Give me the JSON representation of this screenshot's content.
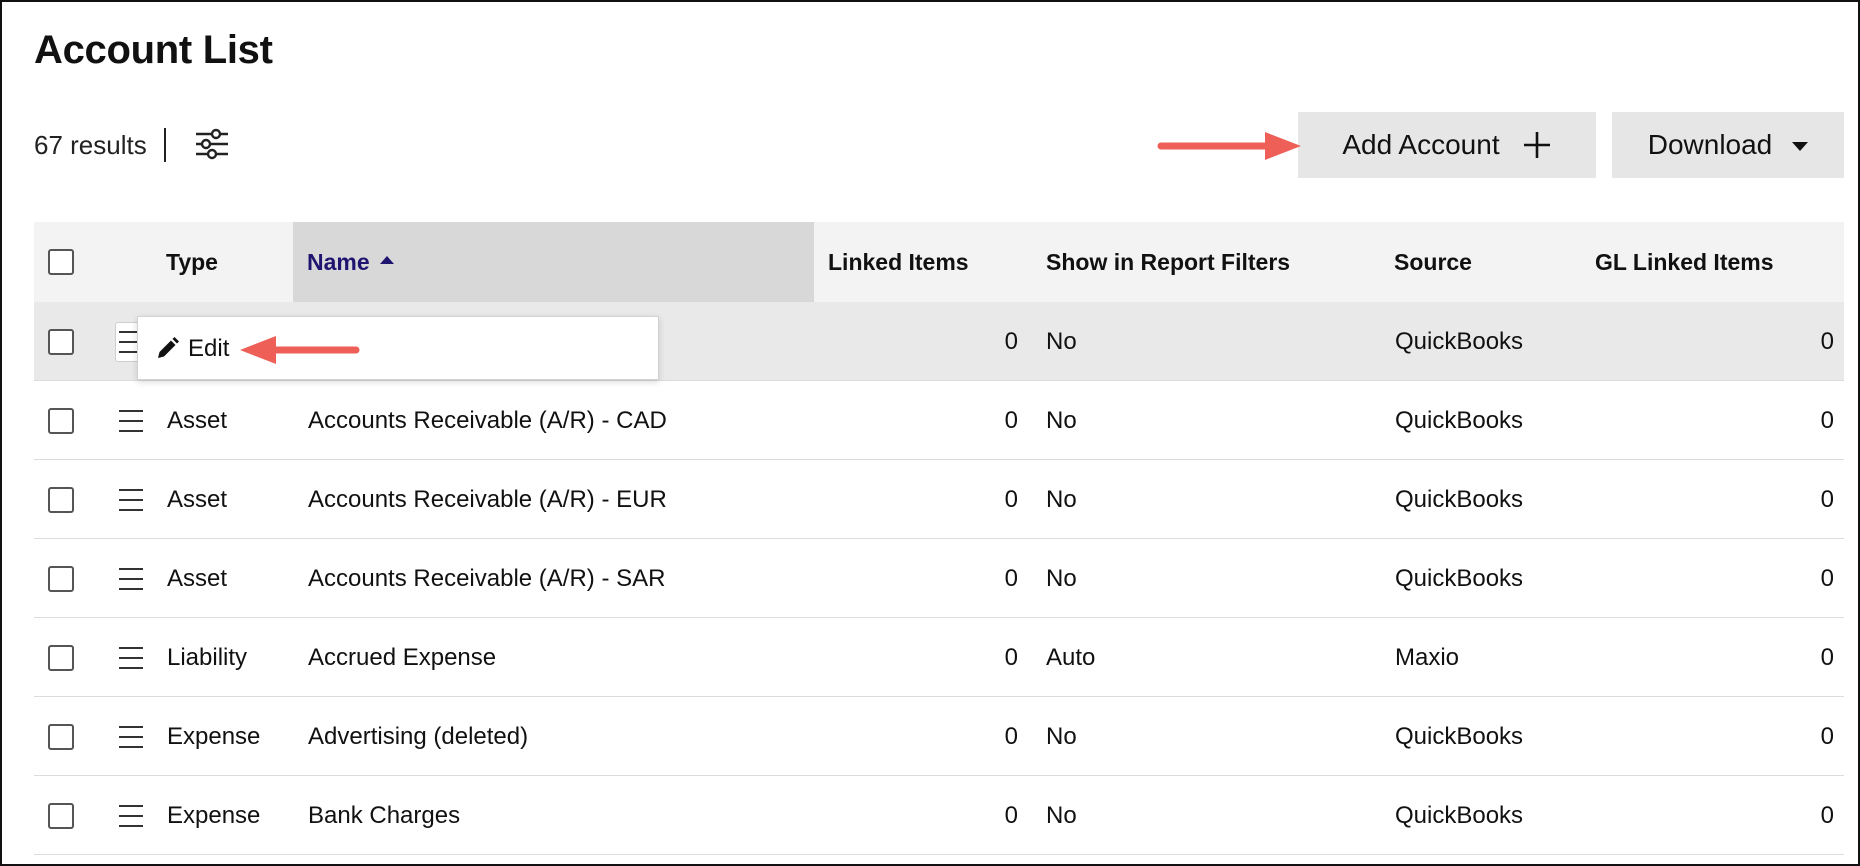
{
  "page": {
    "title": "Account List"
  },
  "toolbar": {
    "results": "67 results",
    "filter_icon": "sliders-icon",
    "add_label": "Add Account",
    "download_label": "Download"
  },
  "columns": {
    "type": "Type",
    "name": "Name",
    "linked_items": "Linked Items",
    "show_in_report_filters": "Show in Report Filters",
    "source": "Source",
    "gl_linked_items": "GL Linked Items"
  },
  "popup": {
    "edit_label": "Edit"
  },
  "rows": [
    {
      "type": "",
      "name": "",
      "linked": "0",
      "show": "No",
      "source": "QuickBooks",
      "gl": "0"
    },
    {
      "type": "Asset",
      "name": "Accounts Receivable (A/R) - CAD",
      "linked": "0",
      "show": "No",
      "source": "QuickBooks",
      "gl": "0"
    },
    {
      "type": "Asset",
      "name": "Accounts Receivable (A/R) - EUR",
      "linked": "0",
      "show": "No",
      "source": "QuickBooks",
      "gl": "0"
    },
    {
      "type": "Asset",
      "name": "Accounts Receivable (A/R) - SAR",
      "linked": "0",
      "show": "No",
      "source": "QuickBooks",
      "gl": "0"
    },
    {
      "type": "Liability",
      "name": "Accrued Expense",
      "linked": "0",
      "show": "Auto",
      "source": "Maxio",
      "gl": "0"
    },
    {
      "type": "Expense",
      "name": "Advertising (deleted)",
      "linked": "0",
      "show": "No",
      "source": "QuickBooks",
      "gl": "0"
    },
    {
      "type": "Expense",
      "name": "Bank Charges",
      "linked": "0",
      "show": "No",
      "source": "QuickBooks",
      "gl": "0"
    }
  ],
  "colors": {
    "sorted_header": "#1f1470",
    "button_bg": "#e6e6e6",
    "arrow": "#ee5f57"
  }
}
